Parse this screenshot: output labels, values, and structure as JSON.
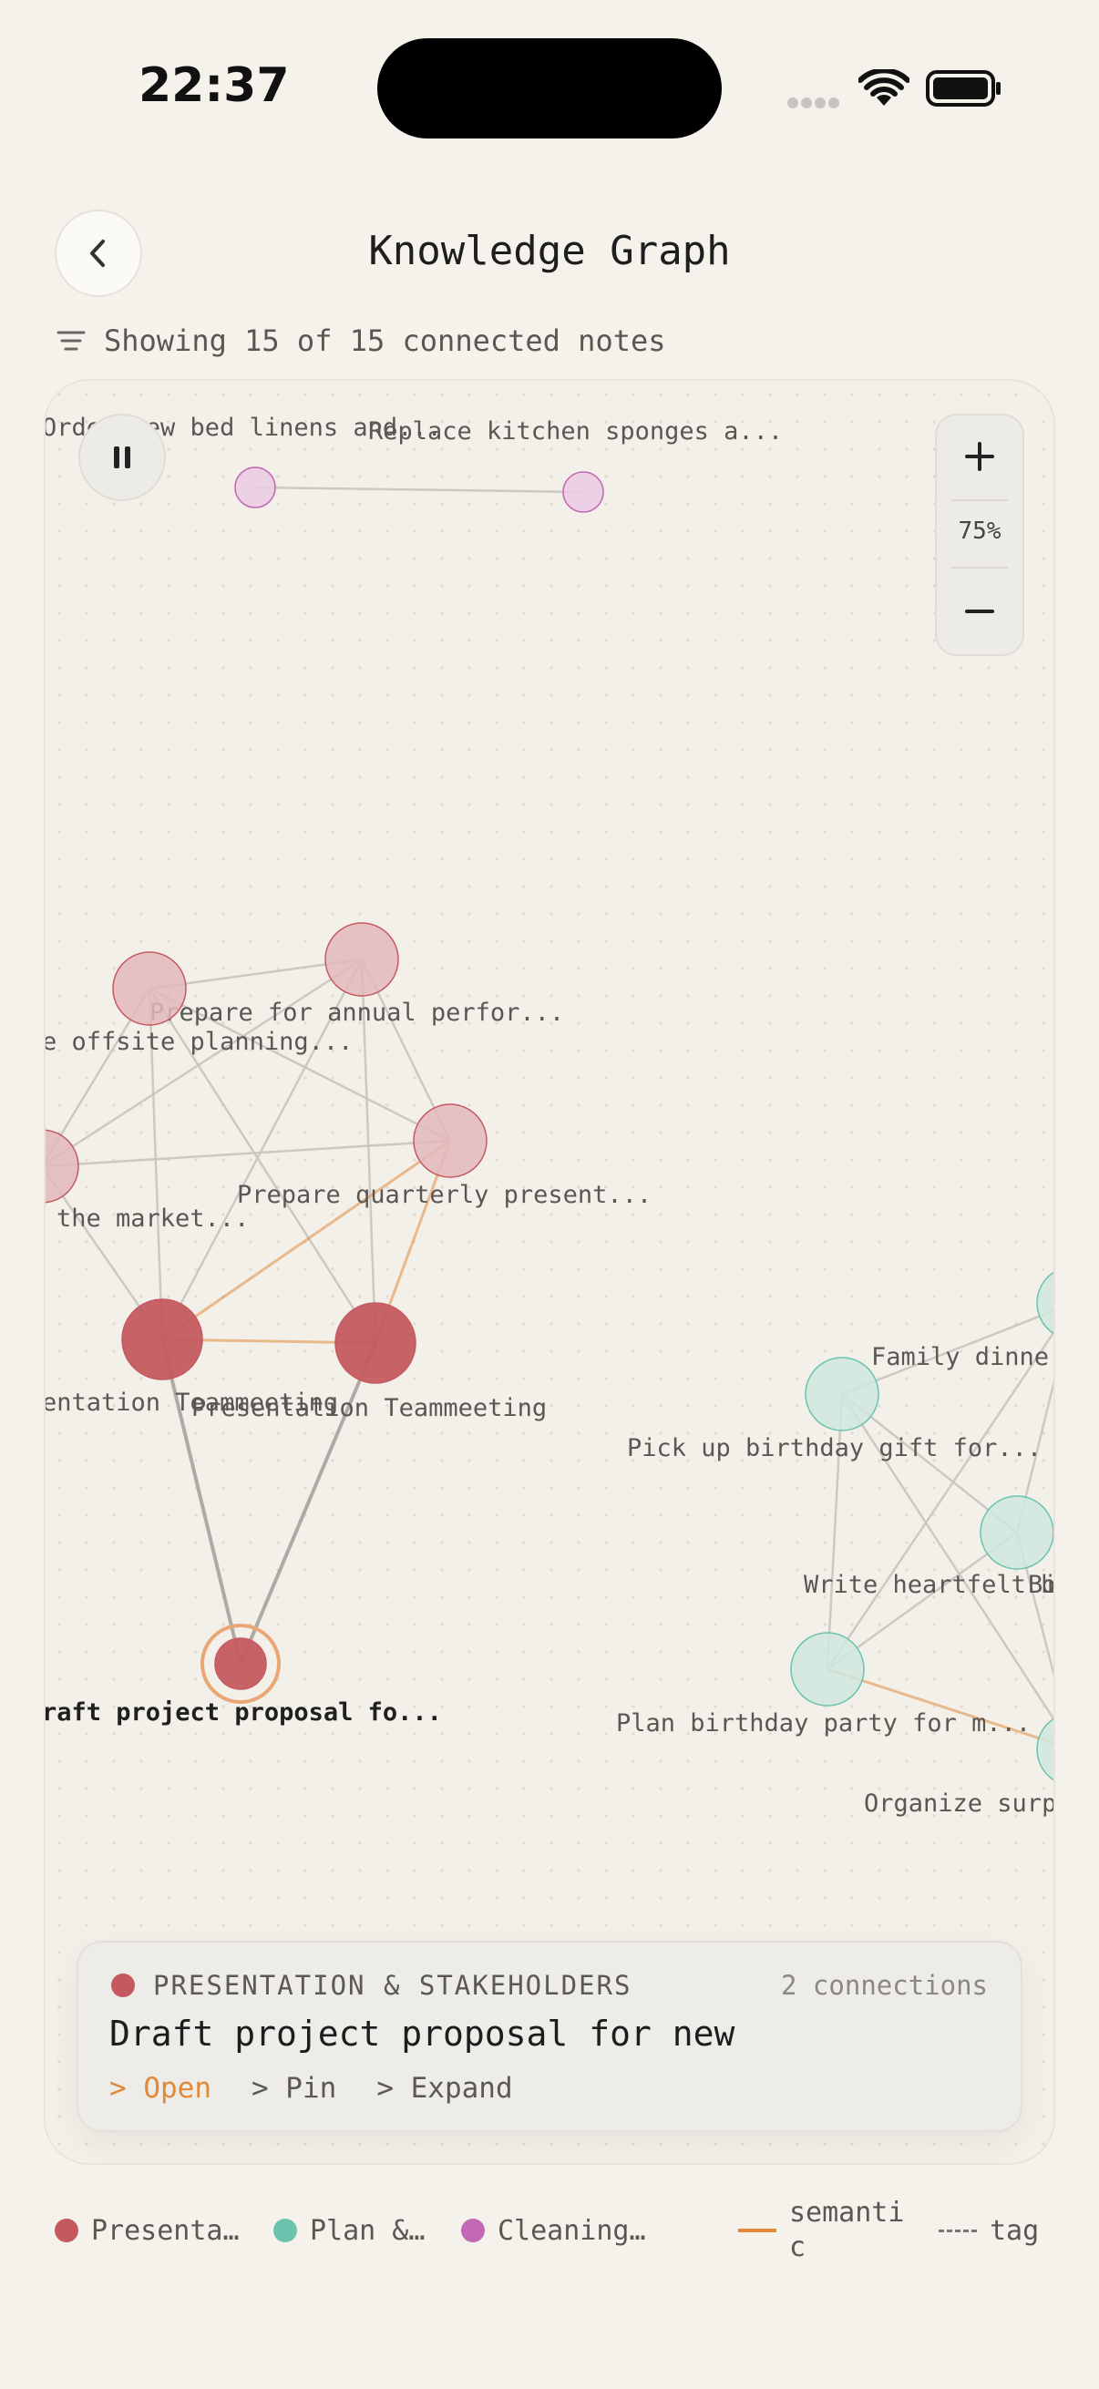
{
  "status": {
    "time": "22:37"
  },
  "header": {
    "title": "Knowledge Graph"
  },
  "filter": {
    "label": "Showing 15 of 15 connected notes"
  },
  "zoom": {
    "level": "75%"
  },
  "colors": {
    "presentation": "#c45a60",
    "presentation_light": "#e3b9bc",
    "plan": "#6ac4ad",
    "plan_light": "#cfe8df",
    "cleaning": "#c268b4",
    "cleaning_light": "#eacbe3",
    "semantic": "#e08a3c",
    "edge": "#c8c4bf"
  },
  "graph": {
    "nodes": [
      {
        "id": "n1",
        "label": "Order new bed linens and...",
        "cluster": "cleaning"
      },
      {
        "id": "n2",
        "label": "Replace kitchen sponges a...",
        "cluster": "cleaning"
      },
      {
        "id": "n3",
        "label": "Prepare for annual perfor...",
        "cluster": "presentation"
      },
      {
        "id": "n4",
        "label": "e offsite planning...",
        "cluster": "presentation"
      },
      {
        "id": "n5",
        "label": " the market...",
        "cluster": "presentation"
      },
      {
        "id": "n6",
        "label": "Prepare quarterly present...",
        "cluster": "presentation"
      },
      {
        "id": "n7",
        "label": "entation Teammeeting",
        "cluster": "presentation"
      },
      {
        "id": "n8",
        "label": "Presentation Teammeeting",
        "cluster": "presentation"
      },
      {
        "id": "n9",
        "label": "raft project proposal fo...",
        "cluster": "presentation",
        "selected": true
      },
      {
        "id": "n10",
        "label": "Family dinne",
        "cluster": "plan"
      },
      {
        "id": "n11",
        "label": "Pick up birthday gift for...",
        "cluster": "plan"
      },
      {
        "id": "n12",
        "label": "Bi",
        "cluster": "plan"
      },
      {
        "id": "n13",
        "label": "Write heartfelt b",
        "cluster": "plan"
      },
      {
        "id": "n14",
        "label": "Plan birthday party for m...",
        "cluster": "plan"
      },
      {
        "id": "n15",
        "label": "Organize surp",
        "cluster": "plan"
      }
    ],
    "edges": [
      [
        "n1",
        "n2",
        "tag"
      ],
      [
        "n4",
        "n3",
        "tag"
      ],
      [
        "n4",
        "n5",
        "tag"
      ],
      [
        "n4",
        "n6",
        "tag"
      ],
      [
        "n4",
        "n7",
        "tag"
      ],
      [
        "n4",
        "n8",
        "tag"
      ],
      [
        "n3",
        "n5",
        "tag"
      ],
      [
        "n3",
        "n6",
        "tag"
      ],
      [
        "n3",
        "n7",
        "tag"
      ],
      [
        "n3",
        "n8",
        "tag"
      ],
      [
        "n5",
        "n6",
        "tag"
      ],
      [
        "n5",
        "n7",
        "tag"
      ],
      [
        "n6",
        "n7",
        "semantic"
      ],
      [
        "n6",
        "n8",
        "semantic"
      ],
      [
        "n7",
        "n8",
        "semantic"
      ],
      [
        "n7",
        "n9",
        "strong"
      ],
      [
        "n8",
        "n9",
        "strong"
      ],
      [
        "n11",
        "n10",
        "tag"
      ],
      [
        "n11",
        "n12",
        "tag"
      ],
      [
        "n11",
        "n14",
        "tag"
      ],
      [
        "n11",
        "n15",
        "tag"
      ],
      [
        "n14",
        "n10",
        "tag"
      ],
      [
        "n14",
        "n12",
        "tag"
      ],
      [
        "n14",
        "n15",
        "semantic"
      ],
      [
        "n12",
        "n15",
        "tag"
      ],
      [
        "n10",
        "n12",
        "tag"
      ]
    ]
  },
  "detail": {
    "cluster": "PRESENTATION & STAKEHOLDERS",
    "connections": "2 connections",
    "title": "Draft project proposal for new",
    "actions": {
      "open": "> Open",
      "pin": "> Pin",
      "expand": "> Expand"
    }
  },
  "legend": {
    "presentation": "Presenta…",
    "plan": "Plan &…",
    "cleaning": "Cleaning…",
    "semantic": "semantic",
    "tag": "tag"
  }
}
